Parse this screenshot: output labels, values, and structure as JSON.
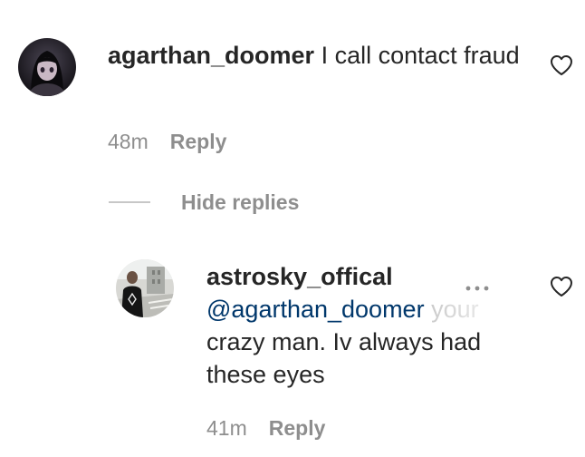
{
  "comments": [
    {
      "username": "agarthan_doomer",
      "text": " I call contact fraud",
      "time": "48m",
      "reply_label": "Reply",
      "avatar_icon": "dark-anime-avatar",
      "like_icon": "heart-outline-icon"
    }
  ],
  "hide_replies_label": "Hide replies",
  "replies": [
    {
      "username": "astrosky_offical",
      "mention": "@agarthan_doomer",
      "text_faded": " your",
      "text_rest": "crazy man. Iv always had these eyes",
      "time": "41m",
      "reply_label": "Reply",
      "avatar_icon": "street-photo-avatar",
      "like_icon": "heart-outline-icon",
      "more_icon": "more-options-icon"
    }
  ],
  "colors": {
    "text": "#262626",
    "secondary": "#8e8e8e",
    "mention": "#00376b",
    "divider": "#c7c7c7"
  }
}
